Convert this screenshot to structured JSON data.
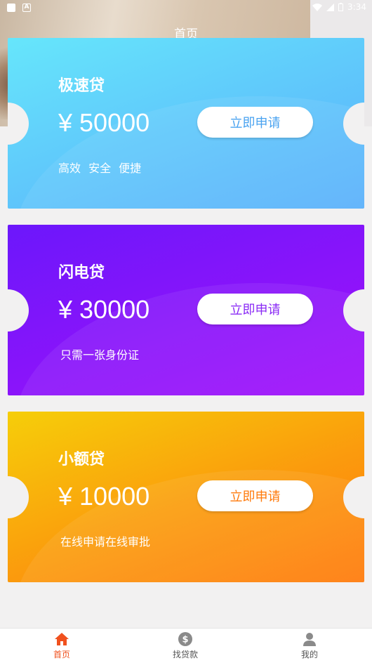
{
  "status_bar": {
    "time": "3:34"
  },
  "header": {
    "title": "首页"
  },
  "cards": [
    {
      "name": "极速贷",
      "amount": "¥ 50000",
      "button": "立即申请",
      "desc": "高效  安全  便捷"
    },
    {
      "name": "闪电贷",
      "amount": "¥ 30000",
      "button": "立即申请",
      "desc": "只需一张身份证"
    },
    {
      "name": "小额贷",
      "amount": "¥ 10000",
      "button": "立即申请",
      "desc": "在线申请在线审批"
    }
  ],
  "bottom_nav": {
    "items": [
      {
        "label": "首页",
        "icon": "home-icon",
        "active": true
      },
      {
        "label": "找贷款",
        "icon": "dollar-coin-icon",
        "active": false
      },
      {
        "label": "我的",
        "icon": "user-icon",
        "active": false
      }
    ]
  },
  "colors": {
    "active_tab": "#f0511e",
    "card1_gradient": [
      "#66e6fb",
      "#5ab0fb"
    ],
    "card2_gradient": [
      "#6c17fb",
      "#a10ffa"
    ],
    "card3_gradient": [
      "#f6ce09",
      "#ff7a0b"
    ]
  }
}
